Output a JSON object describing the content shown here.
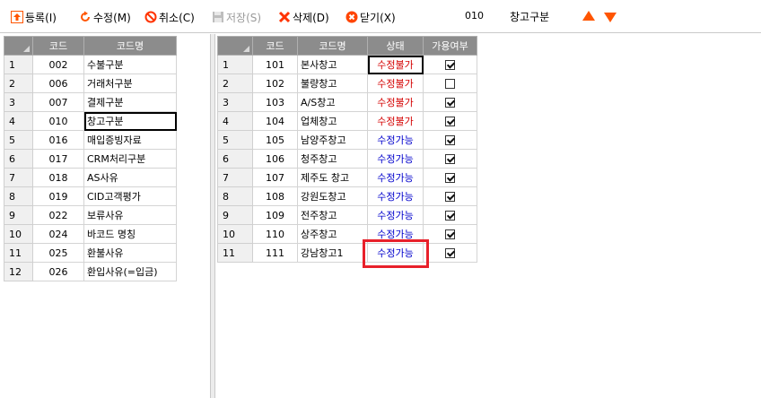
{
  "toolbar": {
    "register": "등록(I)",
    "modify": "수정(M)",
    "cancel": "취소(C)",
    "save": "저장(S)",
    "delete": "삭제(D)",
    "close": "닫기(X)",
    "current_code": "010",
    "current_name": "창고구분"
  },
  "left_grid": {
    "headers": [
      "코드",
      "코드명"
    ],
    "rows": [
      {
        "num": "1",
        "code": "002",
        "name": "수불구분"
      },
      {
        "num": "2",
        "code": "006",
        "name": "거래처구분"
      },
      {
        "num": "3",
        "code": "007",
        "name": "결제구분"
      },
      {
        "num": "4",
        "code": "010",
        "name": "창고구분"
      },
      {
        "num": "5",
        "code": "016",
        "name": "매입증빙자료"
      },
      {
        "num": "6",
        "code": "017",
        "name": "CRM처리구분"
      },
      {
        "num": "7",
        "code": "018",
        "name": "AS사유"
      },
      {
        "num": "8",
        "code": "019",
        "name": "CID고객평가"
      },
      {
        "num": "9",
        "code": "022",
        "name": "보류사유"
      },
      {
        "num": "10",
        "code": "024",
        "name": "바코드 명칭"
      },
      {
        "num": "11",
        "code": "025",
        "name": "환불사유"
      },
      {
        "num": "12",
        "code": "026",
        "name": "환입사유(=입금)"
      }
    ]
  },
  "right_grid": {
    "headers": [
      "코드",
      "코드명",
      "상태",
      "가용여부"
    ],
    "rows": [
      {
        "num": "1",
        "code": "101",
        "name": "본사창고",
        "status": "수정불가",
        "available": true
      },
      {
        "num": "2",
        "code": "102",
        "name": "불량창고",
        "status": "수정불가",
        "available": false
      },
      {
        "num": "3",
        "code": "103",
        "name": "A/S창고",
        "status": "수정불가",
        "available": true
      },
      {
        "num": "4",
        "code": "104",
        "name": "업체창고",
        "status": "수정불가",
        "available": true
      },
      {
        "num": "5",
        "code": "105",
        "name": "남양주창고",
        "status": "수정가능",
        "available": true
      },
      {
        "num": "6",
        "code": "106",
        "name": "청주창고",
        "status": "수정가능",
        "available": true
      },
      {
        "num": "7",
        "code": "107",
        "name": "제주도 창고",
        "status": "수정가능",
        "available": true
      },
      {
        "num": "8",
        "code": "108",
        "name": "강원도창고",
        "status": "수정가능",
        "available": true
      },
      {
        "num": "9",
        "code": "109",
        "name": "전주창고",
        "status": "수정가능",
        "available": true
      },
      {
        "num": "10",
        "code": "110",
        "name": "상주창고",
        "status": "수정가능",
        "available": true
      },
      {
        "num": "11",
        "code": "111",
        "name": "강남창고1",
        "status": "수정가능",
        "available": true
      }
    ]
  },
  "colors": {
    "status_locked": "#d40000",
    "status_editable": "#0000cc",
    "toolbar_accent": "#ff5500",
    "highlight": "#e8202a"
  }
}
